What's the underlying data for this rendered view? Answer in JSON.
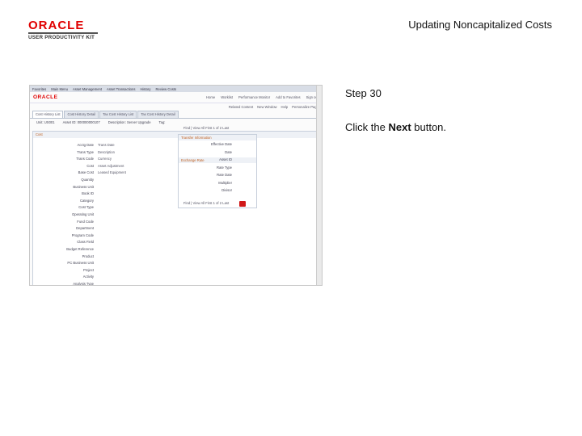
{
  "logo": {
    "brand": "ORACLE",
    "product": "USER PRODUCTIVITY KIT"
  },
  "header": {
    "title": "Updating Noncapitalized Costs"
  },
  "step": {
    "label": "Step 30"
  },
  "instruction": {
    "prefix": "Click the ",
    "target": "Next",
    "suffix": " button."
  },
  "screenshot": {
    "nav_items": [
      "Favorites",
      "Main Menu",
      "Asset Management",
      "Asset Transactions",
      "History",
      "Review Costs"
    ],
    "brand": "ORACLE",
    "top_links": [
      "Home",
      "Worklist",
      "Performance Monitor",
      "Add to Favorites",
      "Sign out"
    ],
    "page_links": [
      "Related Content",
      "New Window",
      "Help",
      "Personalize Page"
    ],
    "tabs": [
      "Cost History List",
      "Cost History Detail",
      "Tax Cost History List",
      "Tax Cost History Detail"
    ],
    "key_fields": [
      "Unit: US001",
      "Asset ID: 000000000107",
      "Description: Server Upgrade",
      "Tag:"
    ],
    "cost_panel_title": "Cost",
    "transfer_title": "Transfer Information",
    "exchange_title": "Exchange Rate",
    "left_labels": [
      "Acctg Date",
      "Trans Type",
      "Trans Code",
      "Cost",
      "Base Cost",
      "Quantity",
      "Business Unit",
      "Book ID",
      "Category",
      "Cost Type",
      "Operating Unit",
      "Fund Code",
      "Department",
      "Program Code",
      "Class Field",
      "Budget Reference",
      "Product",
      "PC Business Unit",
      "Project",
      "Activity",
      "Analysis Type"
    ],
    "left_values": [
      "Trans Date",
      "Description",
      "Currency",
      "Asset Adjustment",
      "Leased Equipment"
    ],
    "right_labels": [
      "Effective Date",
      "Date",
      "Asset ID",
      "Rate Type",
      "Rate Date",
      "Multiplier",
      "Divisor"
    ],
    "pager": "Find | View All     First  1 of 2  Last"
  }
}
